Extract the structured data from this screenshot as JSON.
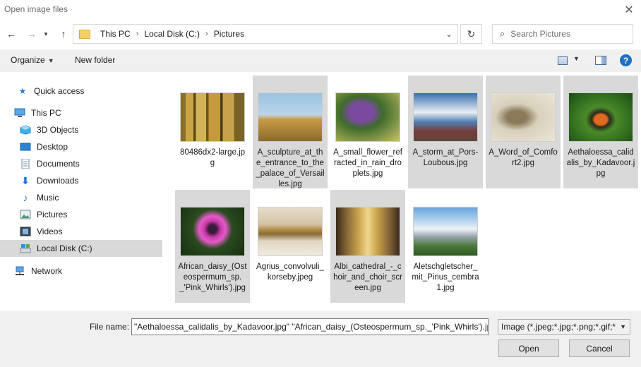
{
  "window": {
    "title": "Open image files"
  },
  "nav": {
    "breadcrumbs": [
      "This PC",
      "Local Disk (C:)",
      "Pictures"
    ],
    "search_placeholder": "Search Pictures"
  },
  "toolbar": {
    "organize": "Organize",
    "new_folder": "New folder"
  },
  "sidebar": {
    "items": [
      {
        "label": "Quick access",
        "icon": "star-icon"
      },
      {
        "label": "This PC",
        "icon": "computer-icon"
      },
      {
        "label": "3D Objects",
        "icon": "cube-icon"
      },
      {
        "label": "Desktop",
        "icon": "desktop-icon"
      },
      {
        "label": "Documents",
        "icon": "document-icon"
      },
      {
        "label": "Downloads",
        "icon": "download-icon"
      },
      {
        "label": "Music",
        "icon": "music-icon"
      },
      {
        "label": "Pictures",
        "icon": "picture-icon"
      },
      {
        "label": "Videos",
        "icon": "video-icon"
      },
      {
        "label": "Local Disk (C:)",
        "icon": "drive-icon"
      },
      {
        "label": "Network",
        "icon": "network-icon"
      }
    ]
  },
  "files": [
    {
      "name": "80486dx2-large.jpg",
      "selected": false
    },
    {
      "name": "A_sculpture_at_the_entrance_to_the_palace_of_Versailles.jpg",
      "selected": true
    },
    {
      "name": "A_small_flower_refracted_in_rain_droplets.jpg",
      "selected": false
    },
    {
      "name": "A_storm_at_Pors-Loubous.jpg",
      "selected": true
    },
    {
      "name": "A_Word_of_Comfort2.jpg",
      "selected": true
    },
    {
      "name": "Aethaloessa_calidalis_by_Kadavoor.jpg",
      "selected": true
    },
    {
      "name": "African_daisy_(Osteospermum_sp._'Pink_Whirls').jpg",
      "selected": true
    },
    {
      "name": "Agrius_convolvuli_korseby.jpeg",
      "selected": false
    },
    {
      "name": "Albi_cathedral_-_choir_and_choir_screen.jpg",
      "selected": true
    },
    {
      "name": "Aletschgletscher_mit_Pinus_cembra1.jpg",
      "selected": false
    }
  ],
  "footer": {
    "file_name_label": "File name:",
    "file_name_value": "\"Aethaloessa_calidalis_by_Kadavoor.jpg\" \"African_daisy_(Osteospermum_sp._'Pink_Whirls').jpg\"",
    "file_type": "Image (*.jpeg;*.jpg;*.png;*.gif;*",
    "open_label": "Open",
    "cancel_label": "Cancel"
  }
}
